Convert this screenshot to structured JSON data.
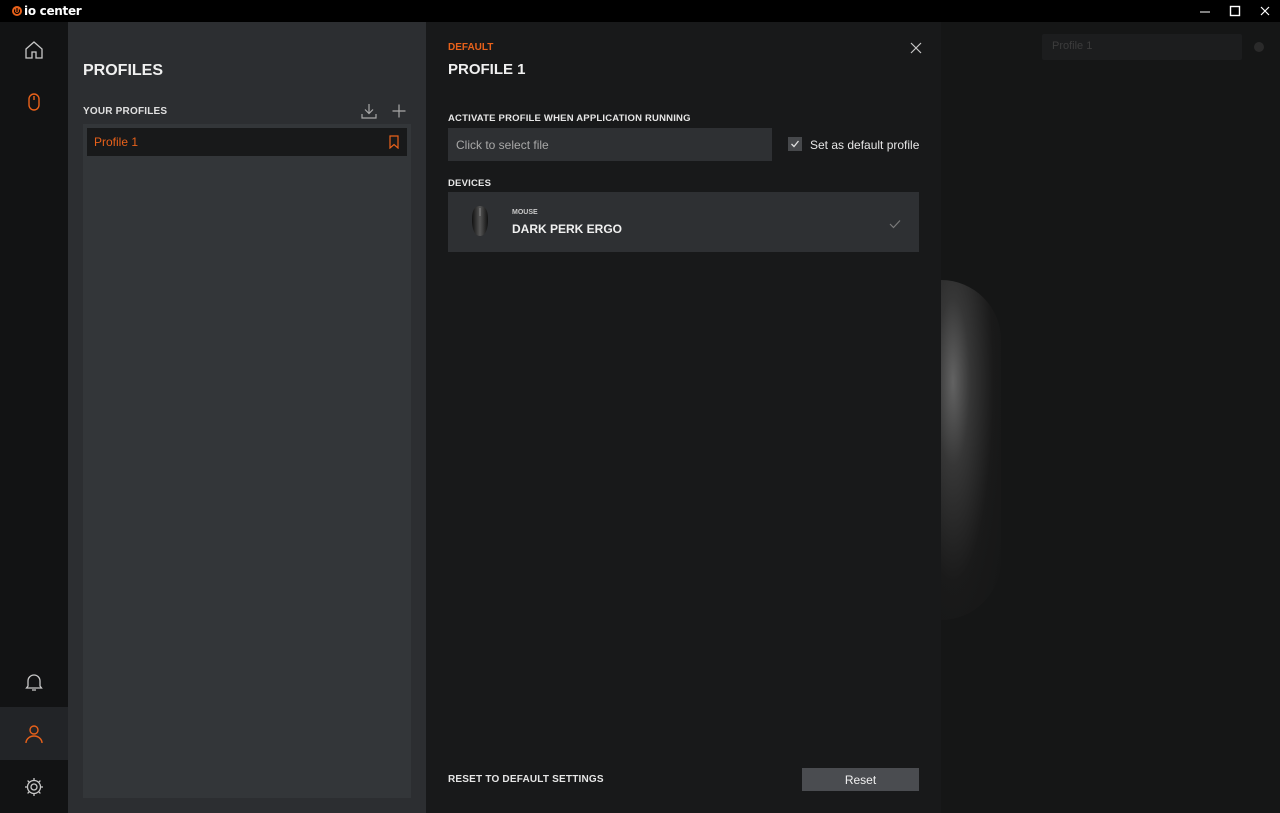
{
  "app": {
    "title": "io center"
  },
  "colors": {
    "accent": "#e8611a",
    "panel": "#2c2e31",
    "detail": "#18191a"
  },
  "window_controls": [
    "minimize-icon",
    "maximize-icon",
    "close-icon"
  ],
  "rail": {
    "top_items": [
      "home-icon",
      "mouse-icon"
    ],
    "bottom_items": [
      "bell-icon",
      "user-icon",
      "gear-icon"
    ],
    "active": "user-icon"
  },
  "background": {
    "profile_select": "Profile 1"
  },
  "profiles": {
    "title": "PROFILES",
    "section": "YOUR PROFILES",
    "items": [
      {
        "label": "Profile 1",
        "selected": true
      }
    ]
  },
  "detail": {
    "tag": "DEFAULT",
    "name": "PROFILE 1",
    "activate_label": "ACTIVATE PROFILE WHEN APPLICATION RUNNING",
    "file_placeholder": "Click to select file",
    "default_checkbox_label": "Set as default profile",
    "default_checked": true,
    "devices_label": "DEVICES",
    "devices": [
      {
        "type": "MOUSE",
        "name": "DARK PERK ERGO"
      }
    ],
    "reset_label": "RESET TO DEFAULT SETTINGS",
    "reset_button": "Reset"
  }
}
